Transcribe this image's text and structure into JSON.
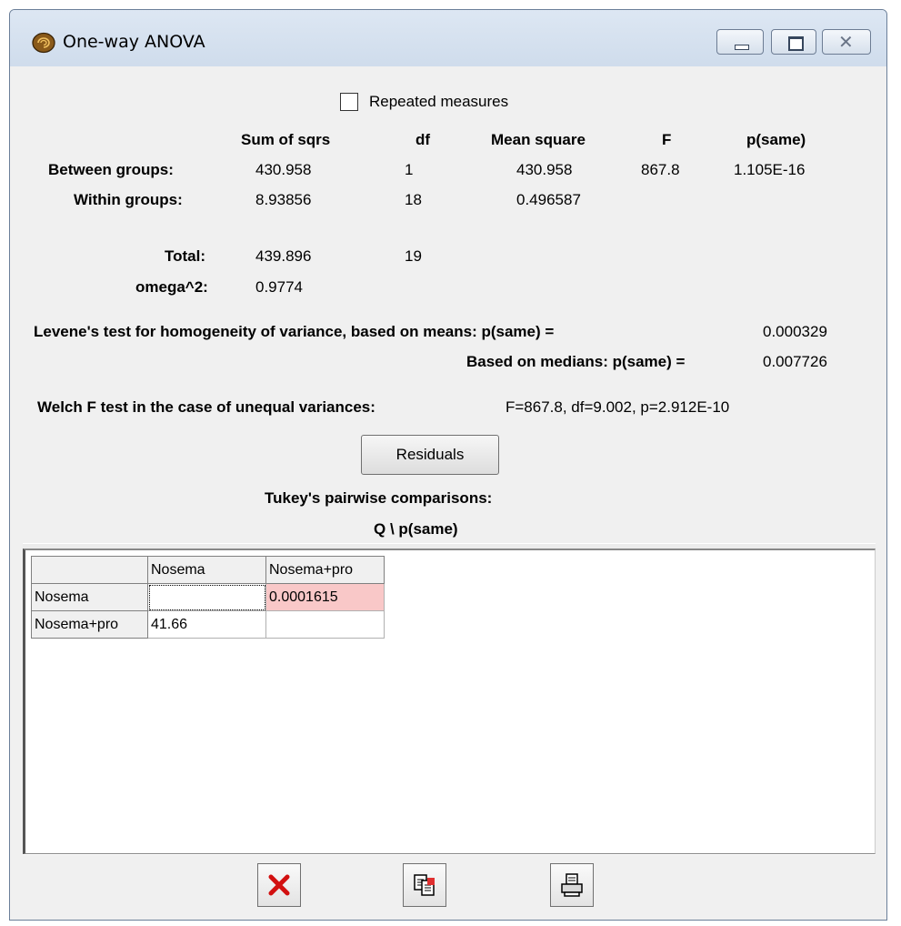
{
  "window": {
    "title": "One-way ANOVA"
  },
  "repeated_measures": {
    "label": "Repeated measures",
    "checked": false
  },
  "anova": {
    "headers": {
      "sum_of_sqrs": "Sum of sqrs",
      "df": "df",
      "mean_square": "Mean square",
      "f": "F",
      "p_same": "p(same)"
    },
    "between": {
      "label": "Between groups:",
      "ss": "430.958",
      "df": "1",
      "ms": "430.958",
      "f": "867.8",
      "p": "1.105E-16"
    },
    "within": {
      "label": "Within groups:",
      "ss": "8.93856",
      "df": "18",
      "ms": "0.496587"
    },
    "total": {
      "label": "Total:",
      "ss": "439.896",
      "df": "19"
    },
    "omega": {
      "label": "omega^2:",
      "value": "0.9774"
    }
  },
  "levene": {
    "means_label": "Levene's test for homogeneity of variance, based on means:  p(same) =",
    "means_value": "0.000329",
    "medians_label": "Based on medians: p(same) =",
    "medians_value": "0.007726"
  },
  "welch": {
    "label": "Welch F test in the case of unequal variances:",
    "value": "F=867.8, df=9.002, p=2.912E-10"
  },
  "residuals_button": "Residuals",
  "tukey": {
    "title": "Tukey's pairwise comparisons:",
    "subtitle": "Q \\ p(same)"
  },
  "grid": {
    "col_headers": [
      "",
      "Nosema",
      "Nosema+pro"
    ],
    "rows": [
      {
        "label": "Nosema",
        "cells": [
          "",
          "0.0001615"
        ]
      },
      {
        "label": "Nosema+pro",
        "cells": [
          "41.66",
          ""
        ]
      }
    ],
    "highlight_color": "#f9c8c8"
  },
  "toolbar": {
    "close_icon": "red-x-icon",
    "copy_icon": "copy-icon",
    "print_icon": "printer-icon"
  }
}
